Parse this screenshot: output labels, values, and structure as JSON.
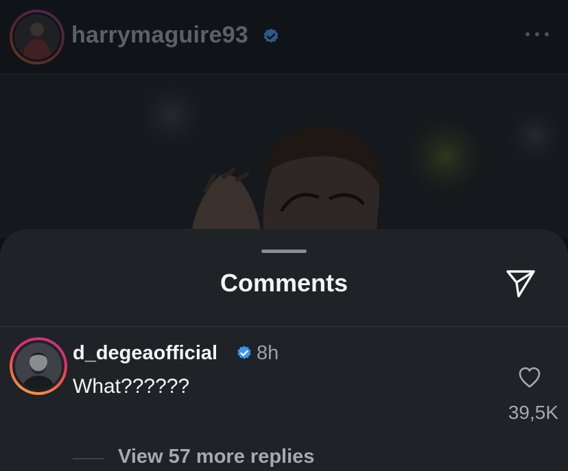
{
  "post": {
    "username": "harrymaguire93",
    "verified": true
  },
  "sheet": {
    "title": "Comments"
  },
  "comment": {
    "username": "d_degeaofficial",
    "verified": true,
    "time": "8h",
    "text": "What??????",
    "likes": "39,5K",
    "view_replies": "View 57 more replies"
  },
  "colors": {
    "sheet_background": "#1f2226",
    "verified_badge": "#3897f0",
    "story_ring_start": "#c13584",
    "story_ring_end": "#fcaf45"
  },
  "icons": {
    "more": "more-horizontal-icon",
    "share": "paper-plane-icon",
    "like": "heart-outline-icon",
    "verified": "verified-badge-icon"
  }
}
